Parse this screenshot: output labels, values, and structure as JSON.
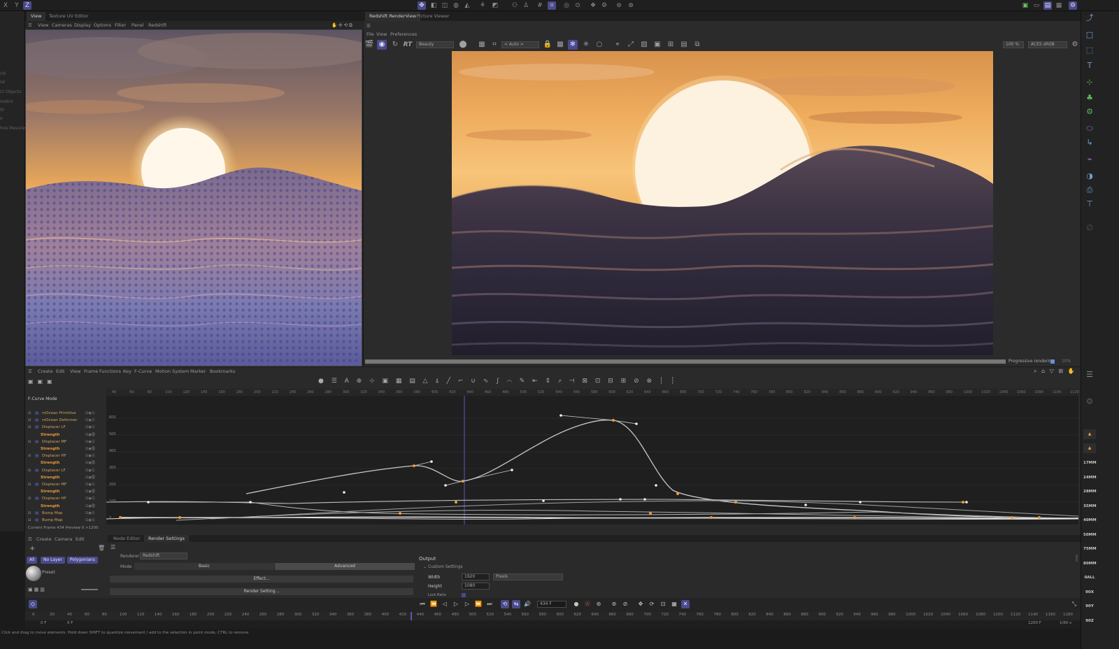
{
  "topbar": {
    "axes": [
      "X",
      "Y",
      "Z"
    ],
    "icons": [
      "move-icon",
      "cube-icon",
      "cylinder-icon",
      "sphere-icon",
      "cone-icon",
      "figure-icon",
      "light-icon",
      "camera-icon",
      "grid-icon",
      "deformer-icon",
      "target-icon",
      "spline-icon",
      "boole-icon",
      "render-icon",
      "render-view-icon",
      "settings-icon"
    ]
  },
  "left_viewport": {
    "tabs": [
      "View",
      "Texture UV Editor"
    ],
    "menu": [
      "View",
      "Cameras",
      "Display",
      "Options",
      "Filter",
      "Panel",
      "Redshift"
    ]
  },
  "left_strip_labels": [
    "",
    "",
    "",
    "rid",
    "ial",
    "ct Objects",
    "metric",
    "th",
    "e",
    "hoe Mesures"
  ],
  "render_view": {
    "tabs": [
      "Redshift RenderView",
      "Picture Viewer"
    ],
    "menu": [
      "File",
      "View",
      "Preferences"
    ],
    "rt_label": "RT",
    "beauty_select": "Beauty",
    "auto_select": "< Auto >",
    "zoom": "100 %",
    "colorspace": "ACES sRGB",
    "progressive_label": "Progressive rendering",
    "progress_pct": "10%"
  },
  "timeline": {
    "menu": [
      "Create",
      "Edit",
      "View",
      "Frame",
      "Functions",
      "Key",
      "F-Curve",
      "Motion System",
      "Marker",
      "Bookmarks"
    ],
    "mode_label": "F-Curve Mode",
    "ruler": [
      "40",
      "60",
      "80",
      "100",
      "120",
      "140",
      "160",
      "180",
      "200",
      "220",
      "240",
      "260",
      "280",
      "300",
      "320",
      "340",
      "360",
      "380",
      "400",
      "420",
      "440",
      "460",
      "480",
      "500",
      "520",
      "540",
      "560",
      "580",
      "600",
      "620",
      "640",
      "660",
      "680",
      "700",
      "720",
      "740",
      "760",
      "780",
      "800",
      "820",
      "840",
      "860",
      "880",
      "900",
      "920",
      "940",
      "960",
      "980",
      "1000",
      "1020",
      "1040",
      "1060",
      "1080",
      "1100",
      "1120"
    ],
    "y_ticks": [
      "600",
      "500",
      "400",
      "300",
      "200",
      "100",
      "0"
    ],
    "tracks": [
      {
        "label": "rsOcean Primitive",
        "type": "obj"
      },
      {
        "label": "rsOcean Deformer",
        "type": "obj"
      },
      {
        "label": "Displacer LF",
        "type": "obj"
      },
      {
        "label": "Strength",
        "type": "str"
      },
      {
        "label": "Displacer MF",
        "type": "obj"
      },
      {
        "label": "Strength",
        "type": "str"
      },
      {
        "label": "Displacer HF",
        "type": "obj"
      },
      {
        "label": "Strength",
        "type": "str"
      },
      {
        "label": "Displacer LF",
        "type": "obj"
      },
      {
        "label": "Strength",
        "type": "str"
      },
      {
        "label": "Displacer MF",
        "type": "obj"
      },
      {
        "label": "Strength",
        "type": "str"
      },
      {
        "label": "Displacer HF",
        "type": "obj"
      },
      {
        "label": "Strength",
        "type": "str"
      },
      {
        "label": "Bump Map",
        "type": "obj"
      },
      {
        "label": "Bump Map",
        "type": "obj"
      }
    ],
    "current_frame_text": "Current Frame  434  Preview  0  >1200"
  },
  "material_panel": {
    "menu": [
      "Create",
      "Camera",
      "Edit"
    ],
    "filters": [
      "All",
      "No Layer",
      "Polygonians"
    ],
    "material_name": "Preset"
  },
  "render_settings": {
    "tabs": [
      "Node Editor",
      "Render Settings"
    ],
    "renderer_label": "Renderer",
    "renderer_value": "Redshift",
    "mode_label": "Mode",
    "mode_basic": "Basic",
    "mode_advanced": "Advanced",
    "effect_button": "Effect...",
    "render_setting_button": "Render Setting...",
    "output_title": "Output",
    "custom_settings": "Custom Settings",
    "width_label": "Width",
    "width_value": "1920",
    "width_unit": "Pixels",
    "height_label": "Height",
    "height_value": "1080",
    "lock_ratio_label": "Lock Ratio"
  },
  "playback": {
    "frame_field": "434 F",
    "ruler": [
      "0",
      "20",
      "40",
      "60",
      "80",
      "100",
      "120",
      "140",
      "160",
      "180",
      "200",
      "220",
      "240",
      "260",
      "280",
      "300",
      "320",
      "340",
      "360",
      "380",
      "400",
      "420",
      "440",
      "460",
      "480",
      "500",
      "520",
      "540",
      "560",
      "580",
      "600",
      "620",
      "640",
      "660",
      "680",
      "700",
      "720",
      "740",
      "760",
      "780",
      "800",
      "820",
      "840",
      "860",
      "880",
      "900",
      "920",
      "940",
      "960",
      "980",
      "1000",
      "1020",
      "1040",
      "1060",
      "1080",
      "1100",
      "1120",
      "1140",
      "1160",
      "1180"
    ],
    "start_field": "0 F",
    "left_field": "0 F",
    "end_field": "1200 F",
    "fps": "1/60 s"
  },
  "right_toolbar_labels": [
    "17MM",
    "24MM",
    "28MM",
    "35MM",
    "40MM",
    "50MM",
    "75MM",
    "80MM",
    "0ALL",
    "90X",
    "90Y",
    "90Z"
  ],
  "status_bar": "Click and drag to move elements. Hold down SHIFT to quantize movement / add to the selection in point mode, CTRL to remove.",
  "colors": {
    "accent": "#4a4a8c",
    "orange": "#e89a3c",
    "sky_top": "#6b5d6e",
    "sun": "#fff6e8"
  }
}
